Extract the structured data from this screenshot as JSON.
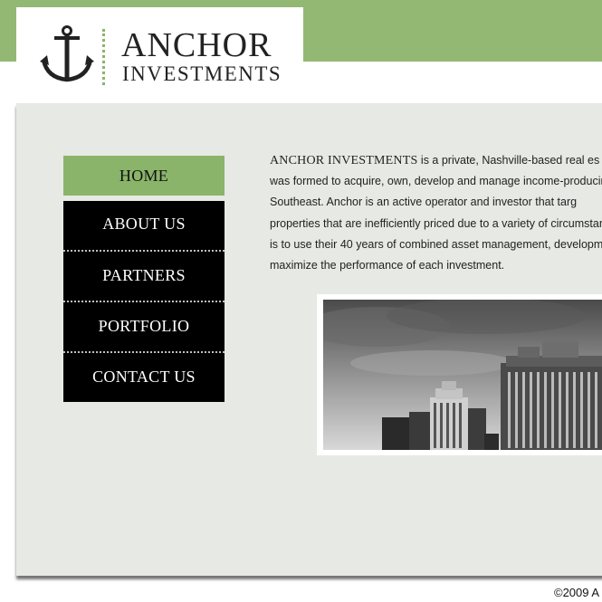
{
  "brand": {
    "name": "ANCHOR",
    "sub": "INVESTMENTS"
  },
  "nav": {
    "items": [
      {
        "label": "HOME",
        "active": true
      },
      {
        "label": "ABOUT US",
        "active": false
      },
      {
        "label": "PARTNERS",
        "active": false
      },
      {
        "label": "PORTFOLIO",
        "active": false
      },
      {
        "label": "CONTACT US",
        "active": false
      }
    ]
  },
  "intro": {
    "company": "ANCHOR INVESTMENTS",
    "lines": [
      " is a private, Nashville-based real es",
      "was formed to acquire, own, develop and manage income-producin",
      "Southeast.  Anchor is an active operator and investor that targ",
      "properties that are inefficiently priced due to a variety of circumstan",
      "is to use their 40 years of combined asset management, developm",
      "maximize the performance of each investment."
    ]
  },
  "footer": {
    "text": "©2009 A"
  },
  "colors": {
    "accent_green": "#93b873",
    "nav_active": "#8ab46a",
    "panel_bg": "#e7e9e5",
    "nav_bg": "#000000"
  }
}
